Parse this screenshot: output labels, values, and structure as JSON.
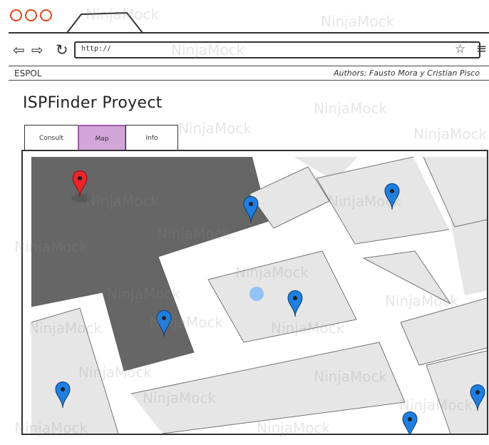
{
  "browser": {
    "url": "http://",
    "back_icon": "arrow-left-icon",
    "forward_icon": "arrow-right-icon",
    "refresh_icon": "refresh-icon",
    "bookmark_icon": "star-icon",
    "menu_icon": "hamburger-menu-icon"
  },
  "header": {
    "brand": "ESPOL",
    "authors": "Authors: Fausto Mora y  Cristian Pisco"
  },
  "page": {
    "title": "ISPFinder Proyect"
  },
  "tabs": [
    {
      "label": "Consult",
      "active": false
    },
    {
      "label": "Map",
      "active": true
    },
    {
      "label": "Info",
      "active": false
    }
  ],
  "map": {
    "markers": [
      {
        "type": "selected",
        "color": "#e8262b"
      },
      {
        "type": "isp",
        "color": "#1e7fe0"
      },
      {
        "type": "isp",
        "color": "#1e7fe0"
      },
      {
        "type": "isp",
        "color": "#1e7fe0"
      },
      {
        "type": "isp",
        "color": "#1e7fe0"
      },
      {
        "type": "isp",
        "color": "#1e7fe0"
      },
      {
        "type": "isp",
        "color": "#1e7fe0"
      },
      {
        "type": "isp",
        "color": "#1e7fe0"
      }
    ],
    "current_location_color": "#93c2f5",
    "highlight_area_color": "#666666",
    "block_color": "#e6e6e6"
  },
  "watermark": "NinjaMock",
  "colors": {
    "active_tab": "#cfa6d6",
    "window_buttons": "#e0471f"
  }
}
